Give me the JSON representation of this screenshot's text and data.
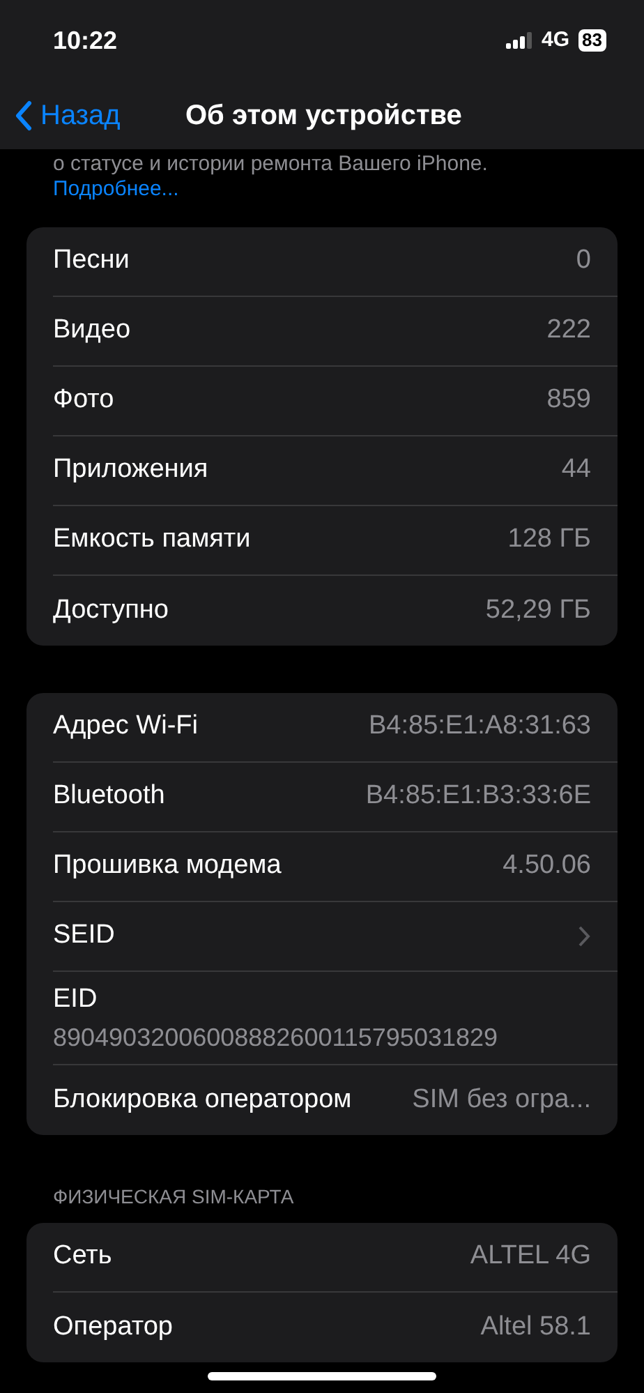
{
  "status_bar": {
    "time": "10:22",
    "network": "4G",
    "battery": "83"
  },
  "nav": {
    "back": "Назад",
    "title": "Об этом устройстве"
  },
  "intro": {
    "text": "о статусе и истории ремонта Вашего iPhone.",
    "link": "Подробнее..."
  },
  "groups": [
    {
      "rows": [
        {
          "kind": "value",
          "label": "Песни",
          "value": "0"
        },
        {
          "kind": "value",
          "label": "Видео",
          "value": "222"
        },
        {
          "kind": "value",
          "label": "Фото",
          "value": "859"
        },
        {
          "kind": "value",
          "label": "Приложения",
          "value": "44"
        },
        {
          "kind": "value",
          "label": "Емкость памяти",
          "value": "128 ГБ"
        },
        {
          "kind": "value",
          "label": "Доступно",
          "value": "52,29 ГБ"
        }
      ]
    },
    {
      "rows": [
        {
          "kind": "value",
          "label": "Адрес Wi-Fi",
          "value": "B4:85:E1:A8:31:63"
        },
        {
          "kind": "value",
          "label": "Bluetooth",
          "value": "B4:85:E1:B3:33:6E"
        },
        {
          "kind": "value",
          "label": "Прошивка модема",
          "value": "4.50.06"
        },
        {
          "kind": "chevron",
          "label": "SEID"
        },
        {
          "kind": "stacked",
          "label": "EID",
          "value": "89049032006008882600115795031829"
        },
        {
          "kind": "value",
          "label": "Блокировка оператором",
          "value": "SIM без огра..."
        }
      ]
    },
    {
      "header": "ФИЗИЧЕСКАЯ SIM-КАРТА",
      "rows": [
        {
          "kind": "value",
          "label": "Сеть",
          "value": "ALTEL 4G"
        },
        {
          "kind": "value",
          "label": "Оператор",
          "value": "Altel 58.1"
        }
      ]
    }
  ]
}
